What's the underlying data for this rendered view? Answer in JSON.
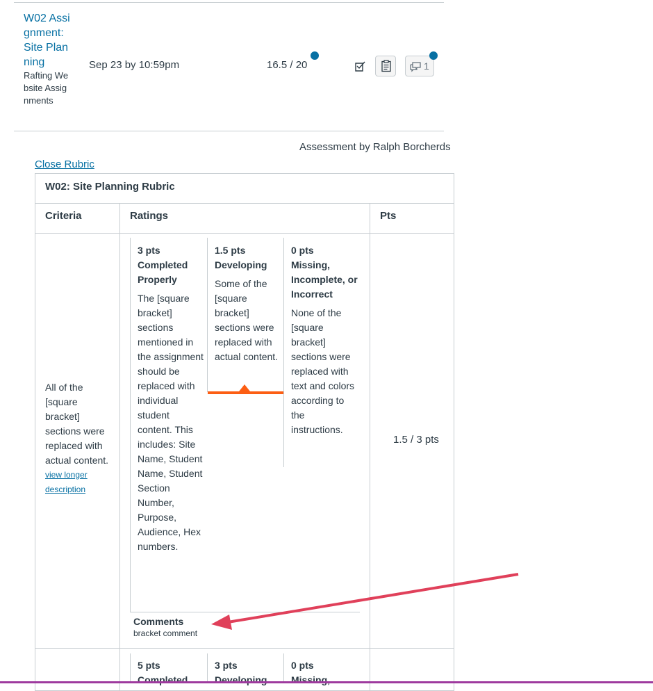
{
  "assignment": {
    "title": "W02 Assignment: Site Planning",
    "group": "Rafting Website Assignments",
    "due": "Sep 23 by 10:59pm",
    "score": "16.5 / 20",
    "comment_count": "1"
  },
  "assessment_by": "Assessment by Ralph Borcherds",
  "close_rubric": "Close Rubric",
  "rubric": {
    "title": "W02: Site Planning Rubric",
    "headers": {
      "criteria": "Criteria",
      "ratings": "Ratings",
      "pts": "Pts"
    },
    "criterion1": {
      "description": "All of the [square bracket] sections were replaced with actual content.",
      "view_longer": "view longer description",
      "ratings": [
        {
          "pts": "3 pts",
          "label": "Completed Properly",
          "desc": "The [square bracket] sections mentioned in the assignment should be replaced with individual student content. This includes: Site Name, Student Name, Student Section Number, Purpose, Audience, Hex numbers."
        },
        {
          "pts": "1.5 pts",
          "label": "Developing",
          "desc": "Some of the [square bracket] sections were replaced with actual content."
        },
        {
          "pts": "0 pts",
          "label": "Missing, Incomplete, or Incorrect",
          "desc": "None of the [square bracket] sections were replaced with text and colors according to the instructions."
        }
      ],
      "comments_label": "Comments",
      "comment": "bracket comment",
      "points": "1.5 / 3 pts"
    },
    "criterion2": {
      "ratings": [
        {
          "pts": "5 pts",
          "label": "Completed"
        },
        {
          "pts": "3 pts",
          "label": "Developing"
        },
        {
          "pts": "0 pts",
          "label": "Missing,"
        }
      ]
    }
  },
  "colors": {
    "link": "#0770a3",
    "selected": "#fc5e13",
    "annotation_arrow": "#e0405a"
  }
}
